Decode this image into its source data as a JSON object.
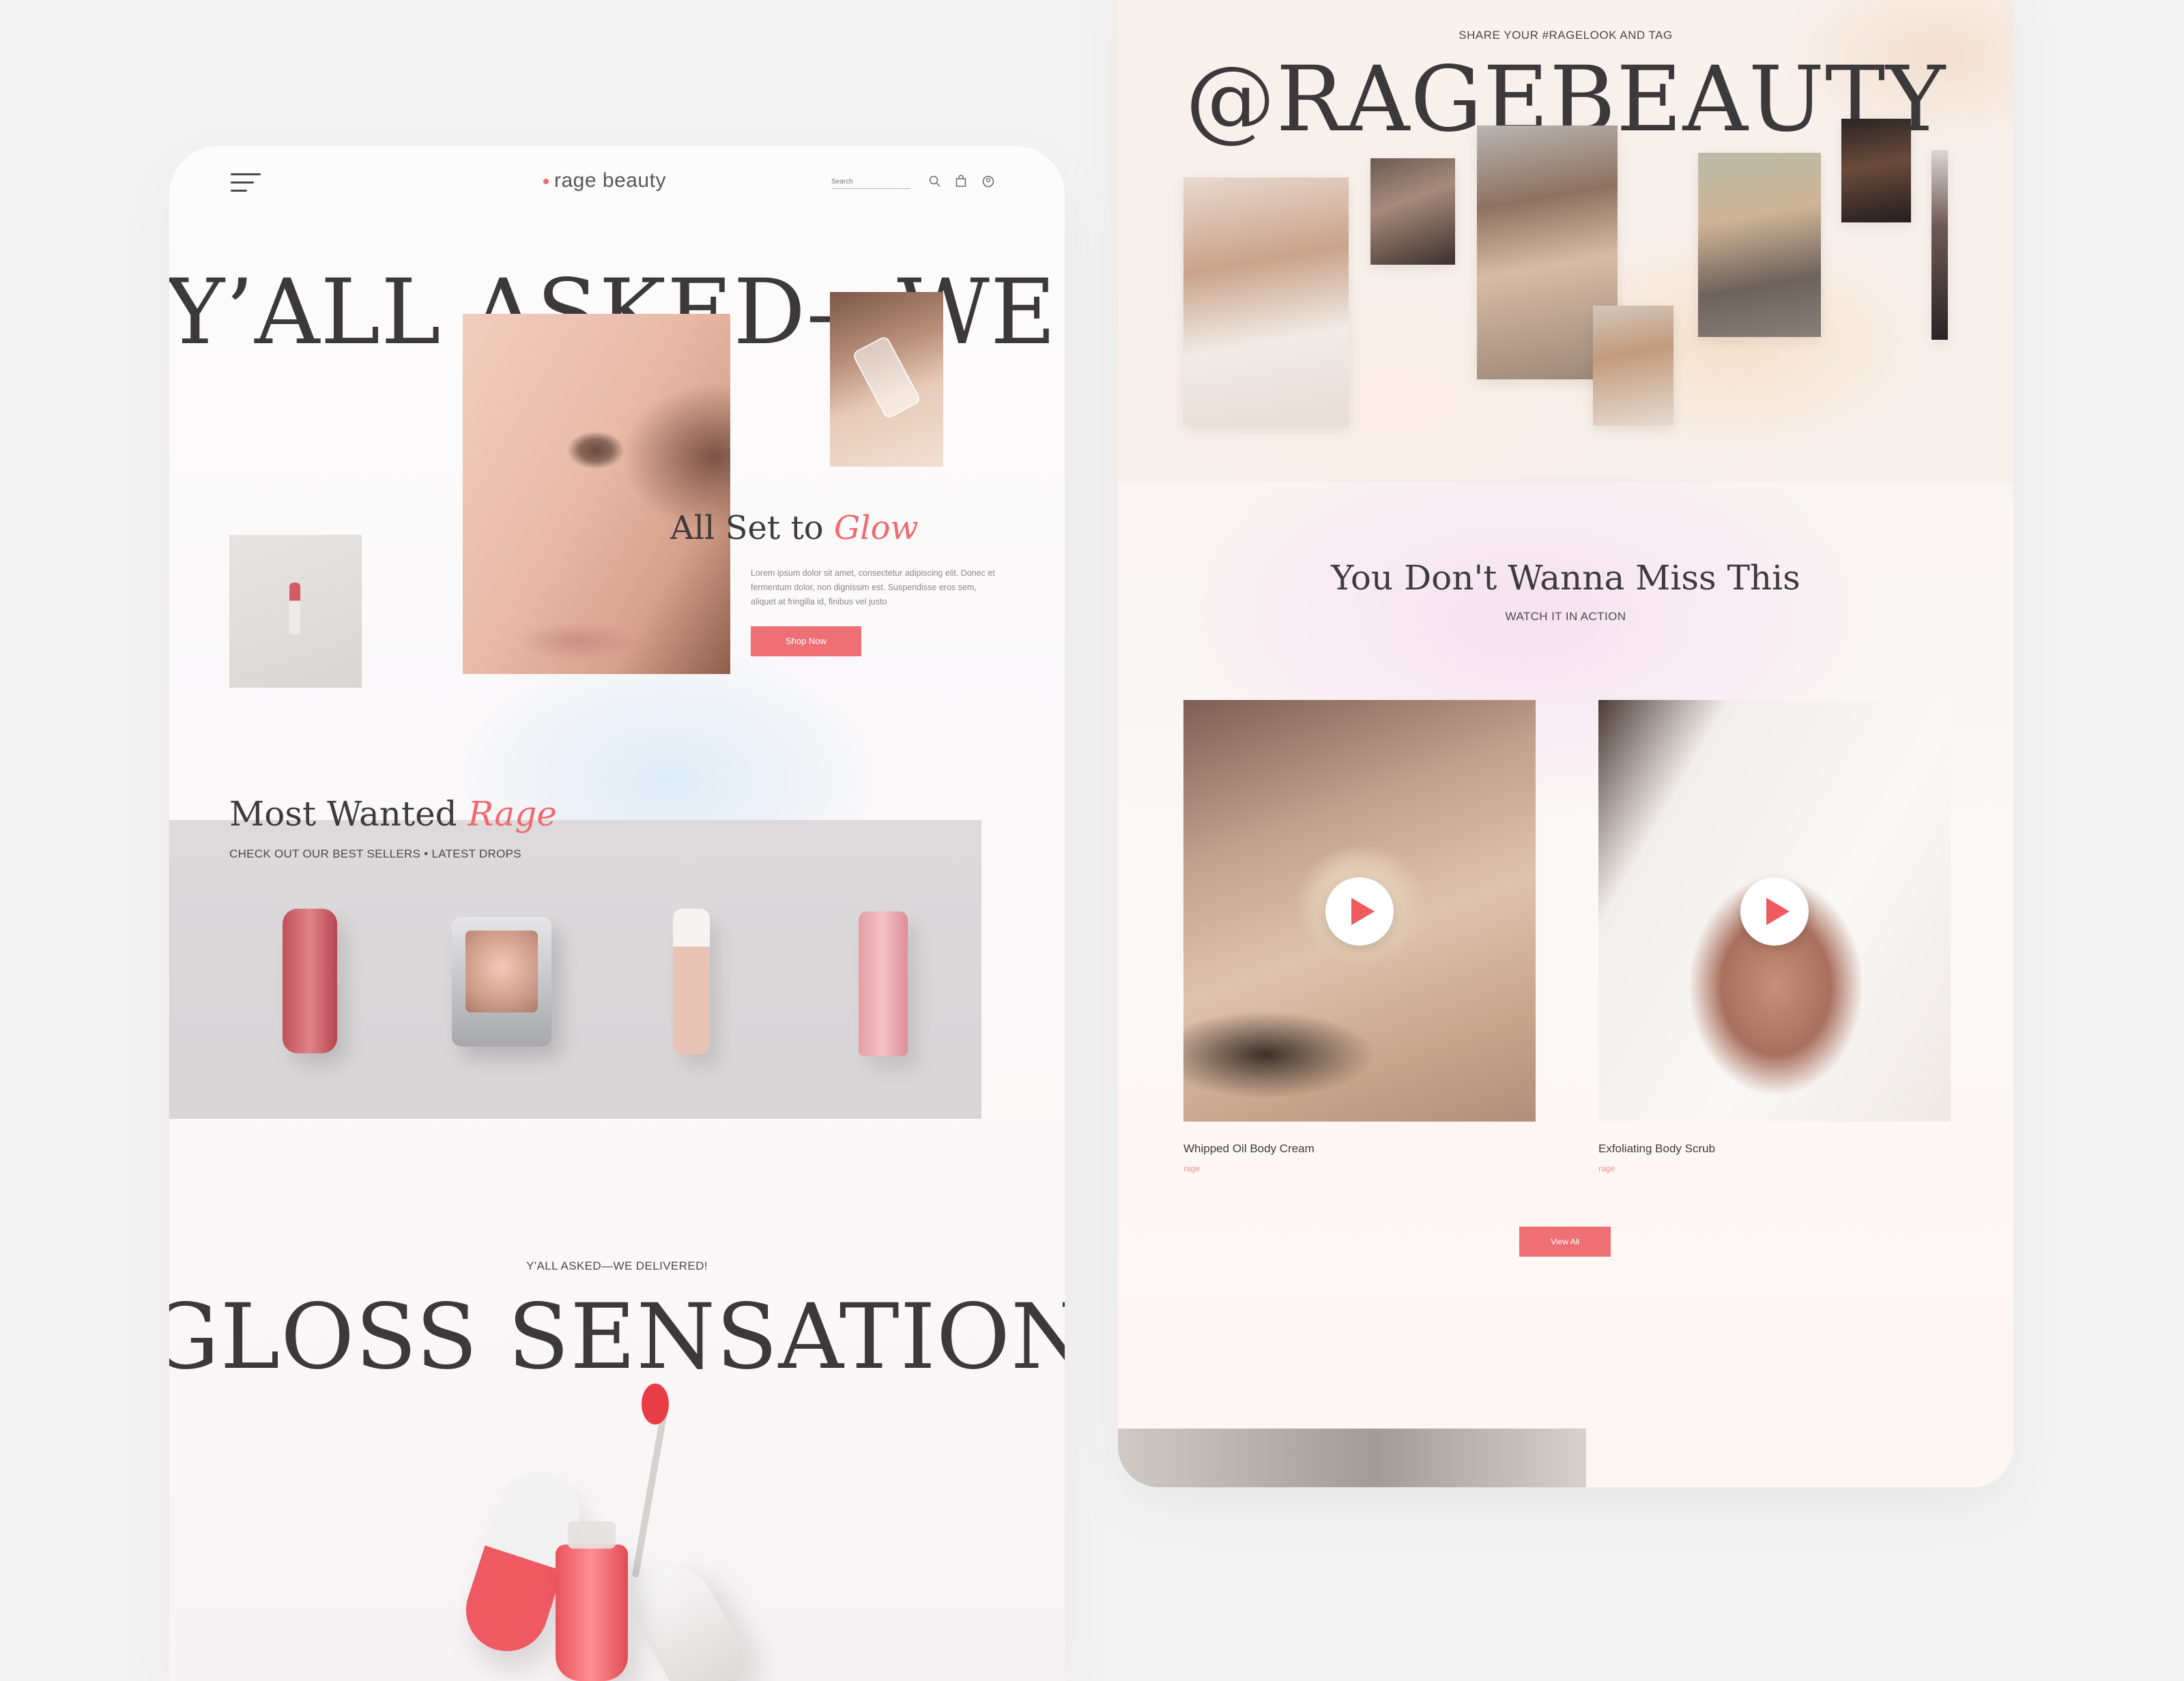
{
  "left_page": {
    "header": {
      "logo": "rage beauty",
      "search_placeholder": "Search",
      "icons": [
        "menu-icon",
        "search-icon",
        "bag-icon",
        "user-icon"
      ]
    },
    "hero": {
      "headline": "Y’ALL ASKED—WE DE",
      "title_main": "All Set to ",
      "title_accent": "Glow",
      "body": "Lorem ipsum dolor sit amet, consectetur adipiscing elit. Donec et fermentum dolor, non dignissim est. Suspendisse eros sem, aliquet at fringilla id, finibus vel justo",
      "cta": "Shop Now"
    },
    "most_wanted": {
      "title_main": "Most Wanted ",
      "title_accent": "Rage",
      "subtitle": "CHECK OUT OUR BEST SELLERS • LATEST DROPS"
    },
    "gloss": {
      "eyebrow": "Y'ALL ASKED—WE DELIVERED!",
      "headline": "GLOSS SENSATIONAL"
    }
  },
  "right_page": {
    "ugc": {
      "eyebrow": "SHARE YOUR #RAGELOOK AND TAG",
      "handle": "@RAGEBEAUTY"
    },
    "videos": {
      "title": "You Don't Wanna Miss This",
      "subtitle": "WATCH IT IN ACTION",
      "items": [
        {
          "name": "Whipped Oil Body Cream",
          "brand": "rage"
        },
        {
          "name": "Exfoliating Body Scrub",
          "brand": "rage"
        }
      ],
      "cta": "View All"
    }
  },
  "colors": {
    "accent": "#ef6a6f",
    "text": "#3c393a",
    "band": "#dad8d9"
  }
}
